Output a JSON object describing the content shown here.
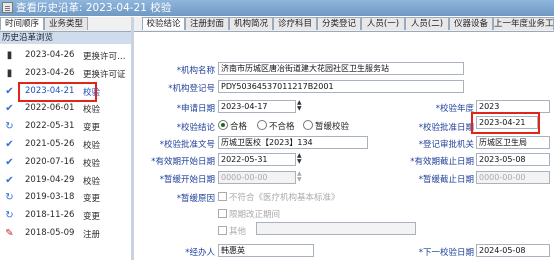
{
  "window": {
    "title": "查看历史沿革: 2023-04-21 校验"
  },
  "left_tabs": [
    "时间顺序",
    "业务类型"
  ],
  "left_header": "历史沿革浏览",
  "history": [
    {
      "date": "2023-04-26",
      "action": "更换许可…",
      "icon": "dark-doc-icon",
      "selected": false
    },
    {
      "date": "2023-04-26",
      "action": "更换许可证",
      "icon": "dark-doc-icon",
      "selected": false
    },
    {
      "date": "2023-04-21",
      "action": "校验",
      "icon": "check-icon",
      "selected": true
    },
    {
      "date": "2022-06-01",
      "action": "校验",
      "icon": "check-icon",
      "selected": false
    },
    {
      "date": "2022-05-31",
      "action": "变更",
      "icon": "refresh-icon",
      "selected": false
    },
    {
      "date": "2021-05-26",
      "action": "校验",
      "icon": "check-icon",
      "selected": false
    },
    {
      "date": "2020-07-16",
      "action": "校验",
      "icon": "check-icon",
      "selected": false
    },
    {
      "date": "2019-04-29",
      "action": "校验",
      "icon": "check-icon",
      "selected": false
    },
    {
      "date": "2019-03-18",
      "action": "变更",
      "icon": "refresh-icon",
      "selected": false
    },
    {
      "date": "2018-11-26",
      "action": "变更",
      "icon": "refresh-icon",
      "selected": false
    },
    {
      "date": "2018-05-09",
      "action": "注册",
      "icon": "pencil-icon",
      "selected": false
    }
  ],
  "right_tabs": [
    "校验结论",
    "注册封面",
    "机构简况",
    "诊疗科目",
    "分类登记",
    "人员(一)",
    "人员(二)",
    "仪器设备",
    "上一年度业务工"
  ],
  "form": {
    "org_name_label": "*机构名称",
    "org_name": "济南市历城区唐冶街道建大花园社区卫生服务站",
    "reg_no_label": "*机构登记号",
    "reg_no": "PDY50364537011217B2001",
    "apply_date_label": "*申请日期",
    "apply_date": "2023-04-17",
    "year_label": "*校验年度",
    "year": "2023",
    "conclusion_label": "*校验结论",
    "conclusion_options": [
      "合格",
      "不合格",
      "暂缓校验"
    ],
    "approve_date_label": "*校验批准日期",
    "approve_date": "2023-04-21",
    "doc_no_label": "*校验批准文号",
    "doc_no": "历城卫医校【2023】134",
    "authority_label": "*登记审批机关",
    "authority": "历城区卫生局",
    "valid_start_label": "*有效期开始日期",
    "valid_start": "2022-05-31",
    "valid_end_label": "*有效期截止日期",
    "valid_end": "2023-05-08",
    "suspend_start_label": "*暂缓开始日期",
    "suspend_start": "0000-00-00",
    "suspend_end_label": "*暂缓截止日期",
    "suspend_end": "0000-00-00",
    "suspend_reason_label": "*暂缓原因",
    "suspend_reasons": [
      "不符合《医疗机构基本标准》",
      "限期改正期间",
      "其他"
    ],
    "handler_label": "*经办人",
    "handler": "韩惠英",
    "next_date_label": "*下一校验日期",
    "next_date": "2024-05-08"
  }
}
